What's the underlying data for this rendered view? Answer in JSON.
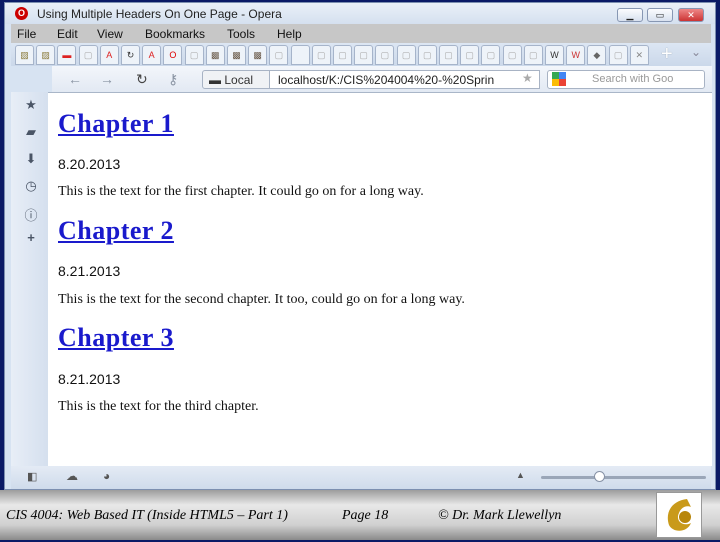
{
  "window": {
    "title": "Using Multiple Headers On One Page - Opera",
    "controls": [
      "minimize",
      "maximize",
      "close"
    ]
  },
  "menu": [
    "File",
    "Edit",
    "View",
    "Bookmarks",
    "Tools",
    "Help"
  ],
  "tabs": [
    "image",
    "image",
    "red",
    "page",
    "adobe",
    "reload",
    "adobe",
    "opera",
    "page",
    "photo",
    "photo",
    "photo",
    "page",
    "blank",
    "page",
    "page",
    "page",
    "page",
    "page",
    "page",
    "page",
    "page",
    "page",
    "page",
    "page",
    "wiki",
    "wiki-red",
    "gray",
    "page"
  ],
  "address": {
    "local_label": "Local",
    "url": "localhost/K:/CIS%204004%20-%20Sprin",
    "search_placeholder": "Search with Goo"
  },
  "sidebar": [
    "bookmarks-star",
    "notes",
    "downloads",
    "history",
    "info",
    "add-panel"
  ],
  "content": {
    "chapters": [
      {
        "title": "Chapter 1",
        "date": "8.20.2013",
        "text": "This is the text for the first chapter. It could go on for a long way."
      },
      {
        "title": "Chapter 2",
        "date": "8.21.2013",
        "text": "This is the text for the second chapter. It too, could go on for a long way."
      },
      {
        "title": "Chapter 3",
        "date": "8.21.2013",
        "text": "This is the text for the third chapter."
      }
    ]
  },
  "status": {
    "zoom_level": 0.35
  },
  "footer": {
    "course": "CIS 4004: Web Based IT (Inside HTML5 – Part 1)",
    "page": "Page 18",
    "author": "© Dr. Mark Llewellyn"
  }
}
